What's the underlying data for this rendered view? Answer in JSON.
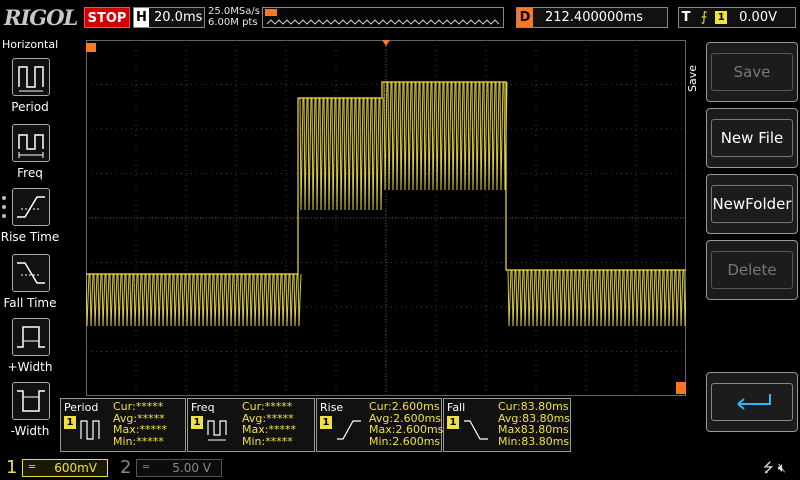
{
  "colors": {
    "ch1": "#f0e040",
    "ch2": "#888888",
    "stop": "#d40000",
    "marker": "#ff7722",
    "grid": "#3a3a3a"
  },
  "header": {
    "brand": "RIGOL",
    "run_state": "STOP",
    "timebase_label": "H",
    "timebase_value": "20.0ms",
    "sample_rate": "25.0MSa/s",
    "memory_depth": "6.00M pts",
    "delay_label": "D",
    "delay_value": "212.400000ms",
    "trigger_label": "T",
    "trigger_edge_icon": "rising-edge-icon",
    "trigger_source": "1",
    "trigger_level": "0.00V"
  },
  "left_menu": {
    "title": "Horizontal",
    "items": [
      {
        "label": "Period",
        "icon": "period-icon"
      },
      {
        "label": "Freq",
        "icon": "frequency-icon"
      },
      {
        "label": "Rise Time",
        "icon": "rise-time-icon"
      },
      {
        "label": "Fall Time",
        "icon": "fall-time-icon"
      },
      {
        "label": "+Width",
        "icon": "positive-width-icon"
      },
      {
        "label": "-Width",
        "icon": "negative-width-icon"
      }
    ]
  },
  "right_menu": {
    "title": "Save",
    "items": [
      {
        "label": "Save",
        "enabled": false
      },
      {
        "label": "New File",
        "enabled": true
      },
      {
        "label": "NewFolder",
        "enabled": true
      },
      {
        "label": "Delete",
        "enabled": false
      },
      {
        "label": "",
        "icon": "back-arrow-icon",
        "enabled": true
      }
    ]
  },
  "measurements": [
    {
      "name": "Period",
      "channel": "1",
      "cur": "Cur:*****",
      "avg": "Avg:*****",
      "max": "Max:*****",
      "min": "Min:*****"
    },
    {
      "name": "Freq",
      "channel": "1",
      "cur": "Cur:*****",
      "avg": "Avg:*****",
      "max": "Max:*****",
      "min": "Min:*****"
    },
    {
      "name": "Rise",
      "channel": "1",
      "cur": "Cur:2.600ms",
      "avg": "Avg:2.600ms",
      "max": "Max:2.600ms",
      "min": "Min:2.600ms"
    },
    {
      "name": "Fall",
      "channel": "1",
      "cur": "Cur:83.80ms",
      "avg": "Avg:83.80ms",
      "max": "Max83.80ms",
      "min": "Min:83.80ms"
    }
  ],
  "channels": [
    {
      "number": "1",
      "scale": "600mV",
      "active": true
    },
    {
      "number": "2",
      "scale": "5.00 V",
      "active": false
    }
  ],
  "status_icons": [
    "usb-icon",
    "speaker-muted-icon"
  ]
}
